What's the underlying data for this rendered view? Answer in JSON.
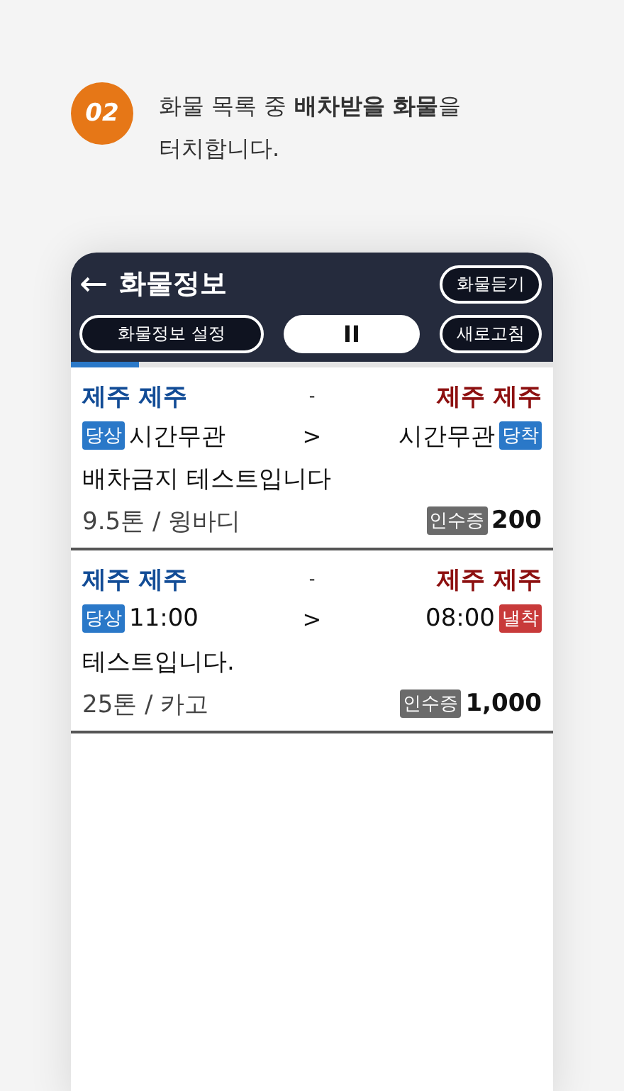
{
  "step": {
    "number": "02",
    "text": "화물 목록 중 **배차받을 화물**을 터치합니다."
  },
  "header": {
    "back": "←",
    "title": "화물정보",
    "listen_button": "화물듣기",
    "settings_button": "화물정보 설정",
    "pause_button": "II",
    "refresh_button": "새로고침"
  },
  "progress": {
    "level": 0.14
  },
  "cargo": [
    {
      "from": "제주 제주",
      "dash": "-",
      "to": "제주 제주",
      "from_badge": {
        "label": "당상",
        "color": "#2a78c8"
      },
      "from_time": "시간무관",
      "arrow": ">",
      "to_time": "시간무관",
      "to_badge": {
        "label": "당착",
        "color": "#2a78c8"
      },
      "title": "배차금지 테스트입니다",
      "spec": "9.5톤 / 윙바디",
      "receipt": "인수증",
      "price": "200"
    },
    {
      "from": "제주 제주",
      "dash": "-",
      "to": "제주 제주",
      "from_badge": {
        "label": "당상",
        "color": "#2a78c8"
      },
      "from_time": "11:00",
      "arrow": ">",
      "to_time": "08:00",
      "to_badge": {
        "label": "낼착",
        "color": "#c83a3a"
      },
      "title": "테스트입니다.",
      "spec": "25톤 / 카고",
      "receipt": "인수증",
      "price": "1,000"
    }
  ]
}
